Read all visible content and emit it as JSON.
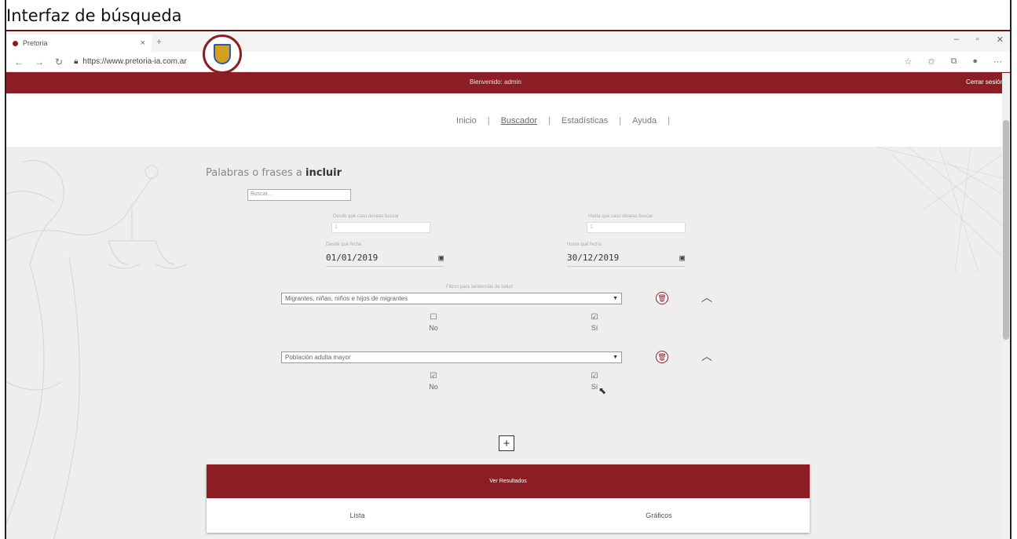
{
  "slide": {
    "title": "Interfaz de búsqueda"
  },
  "browser": {
    "tab_label": "Pretoria",
    "tab_close": "×",
    "new_tab": "+",
    "url": "https://www.pretoria-ia.com.ar"
  },
  "site": {
    "welcome": "Bienvenido: admin",
    "logout": "Cerrar sesión",
    "nav": [
      {
        "label": "Inicio"
      },
      {
        "label": "Buscador",
        "active": true
      },
      {
        "label": "Estadísticas"
      },
      {
        "label": "Ayuda"
      }
    ],
    "nav_separator": "|"
  },
  "search": {
    "heading_prefix": "Palabras o frases a ",
    "heading_bold": "incluir",
    "placeholder": "Buscar...",
    "case_from_label": "Desde qué caso deseas buscar",
    "case_from_placeholder": "1",
    "case_to_label": "Hasta qué caso deseas buscar",
    "case_to_placeholder": "1",
    "date_from_label": "Desde qué fecha",
    "date_from": "01/01/2019",
    "date_to_label": "Hasta qué fecha",
    "date_to": "30/12/2019"
  },
  "filters": {
    "title": "Filtros para sentencias de salud",
    "items": [
      {
        "selected": "Migrantes, niñas, niños e hijos de migrantes",
        "no_checked": false,
        "si_checked": true
      },
      {
        "selected": "Población adulta mayor",
        "no_checked": true,
        "si_checked": true
      }
    ],
    "no_label": "No",
    "si_label": "Sí",
    "add_symbol": "+"
  },
  "results": {
    "header": "Ver Resultados",
    "option_list": "Lista",
    "option_charts": "Gráficos"
  },
  "colors": {
    "brand": "#8b1e24",
    "background": "#efeeee"
  }
}
